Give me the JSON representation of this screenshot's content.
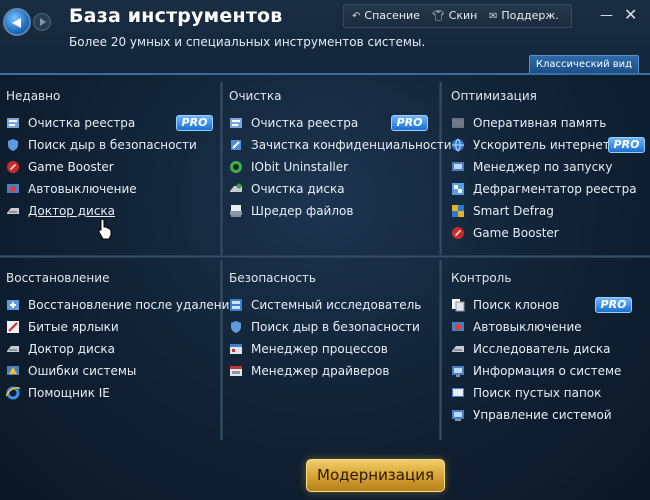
{
  "header": {
    "title": "База инструментов",
    "subtitle": "Более 20 умных и специальных инструментов системы.",
    "links": {
      "rescue": "Спасение",
      "skin": "Скин",
      "support": "Поддерж."
    },
    "classic_view": "Классический вид"
  },
  "sections": {
    "recent": {
      "title": "Недавно",
      "items": [
        "Очистка реестра",
        "Поиск дыр в безопасности",
        "Game Booster",
        "Автовыключение",
        "Доктор диска"
      ]
    },
    "cleanup": {
      "title": "Очистка",
      "items": [
        "Очистка реестра",
        "Зачистка конфиденциальности",
        "IObit Uninstaller",
        "Очистка диска",
        "Шредер файлов"
      ]
    },
    "optimization": {
      "title": "Оптимизация",
      "items": [
        "Оперативная память",
        "Ускоритель интернета",
        "Менеджер по запуску",
        "Дефрагментатор реестра",
        "Smart Defrag",
        "Game Booster"
      ]
    },
    "recovery": {
      "title": "Восстановление",
      "items": [
        "Восстановление после удаления",
        "Битые ярлыки",
        "Доктор диска",
        "Ошибки системы",
        "Помощник IE"
      ]
    },
    "security": {
      "title": "Безопасность",
      "items": [
        "Системный исследователь",
        "Поиск дыр в безопасности",
        "Менеджер процессов",
        "Менеджер драйверов"
      ]
    },
    "control": {
      "title": "Контроль",
      "items": [
        "Поиск клонов",
        "Автовыключение",
        "Исследователь диска",
        "Информация о системе",
        "Поиск пустых папок",
        "Управление системой"
      ]
    }
  },
  "badge": "PRO",
  "upgrade_button": "Модернизация",
  "colors": {
    "accent": "#2f6aa8",
    "pro_badge": "#1b6fd0",
    "upgrade": "#d8a534"
  }
}
